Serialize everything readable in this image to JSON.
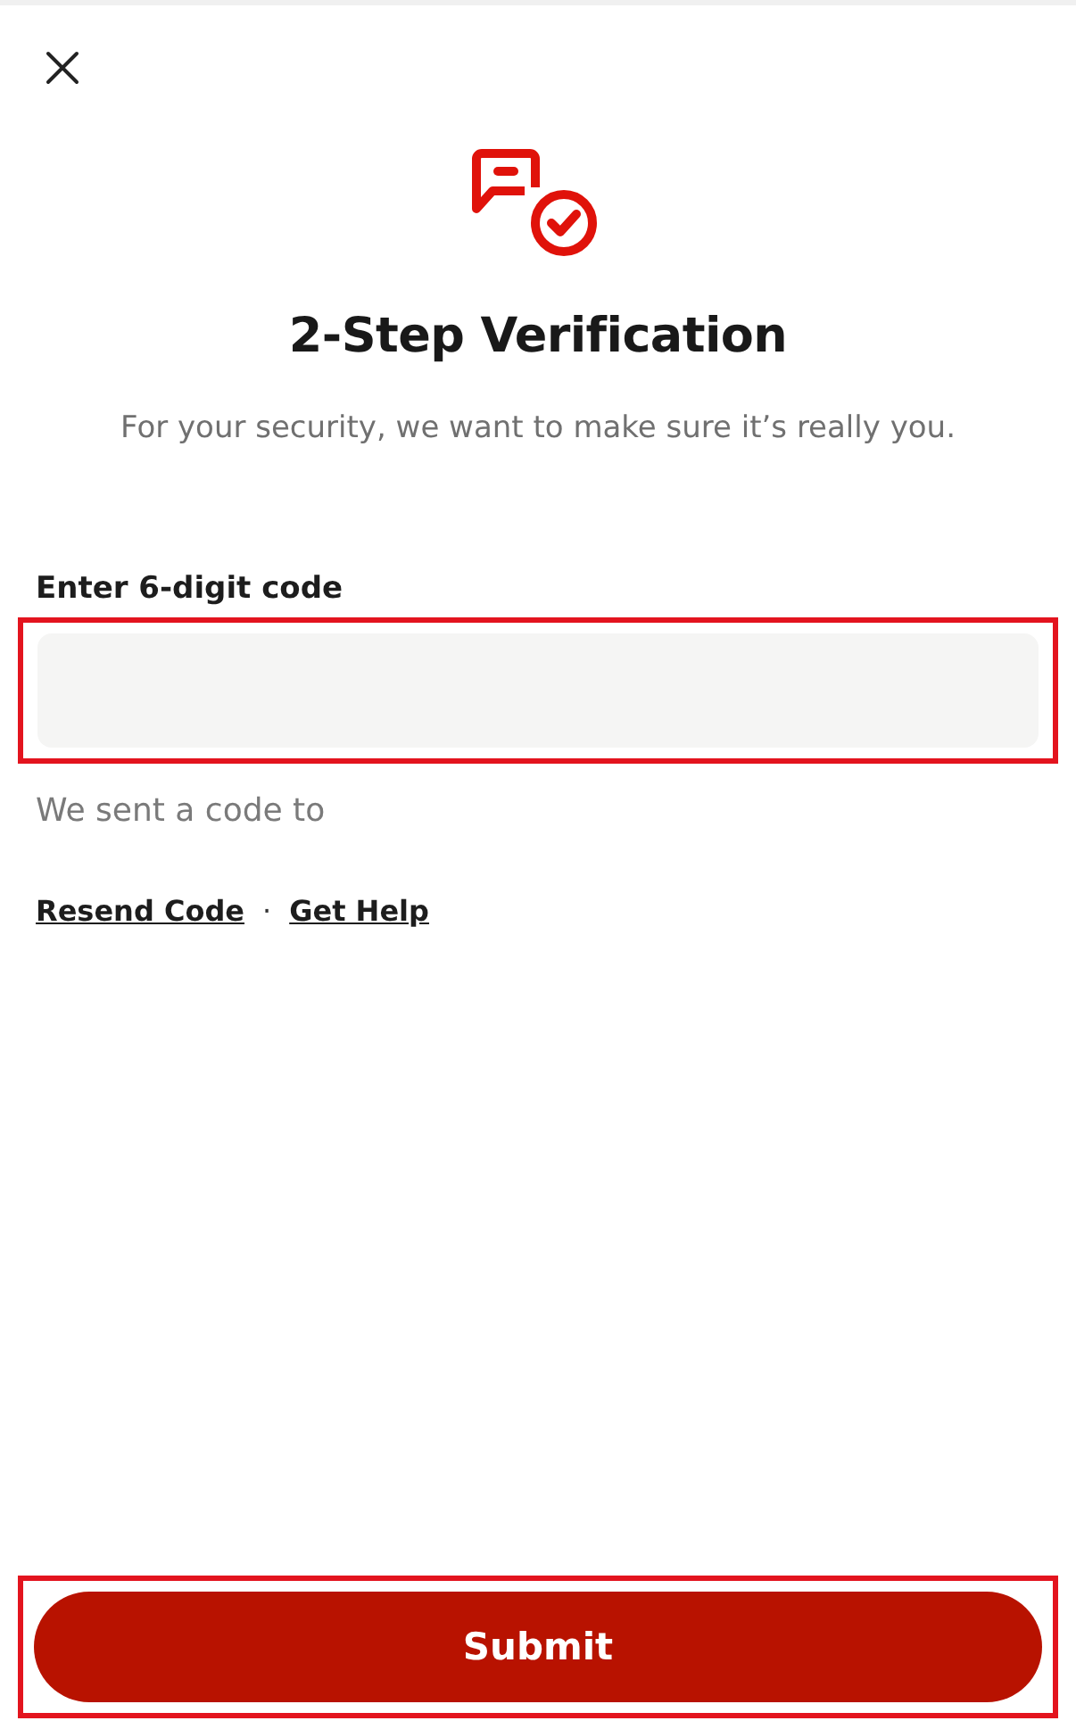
{
  "title": "2-Step Verification",
  "subtitle": "For your security, we want to make sure it’s really you.",
  "code_field": {
    "label": "Enter 6-digit code",
    "highlighted": true
  },
  "sent_note": "We sent a code to",
  "links": [
    {
      "label": "Resend Code"
    },
    {
      "label": "Get Help"
    }
  ],
  "link_separator": "·",
  "submit": {
    "label": "Submit",
    "highlighted": true
  }
}
